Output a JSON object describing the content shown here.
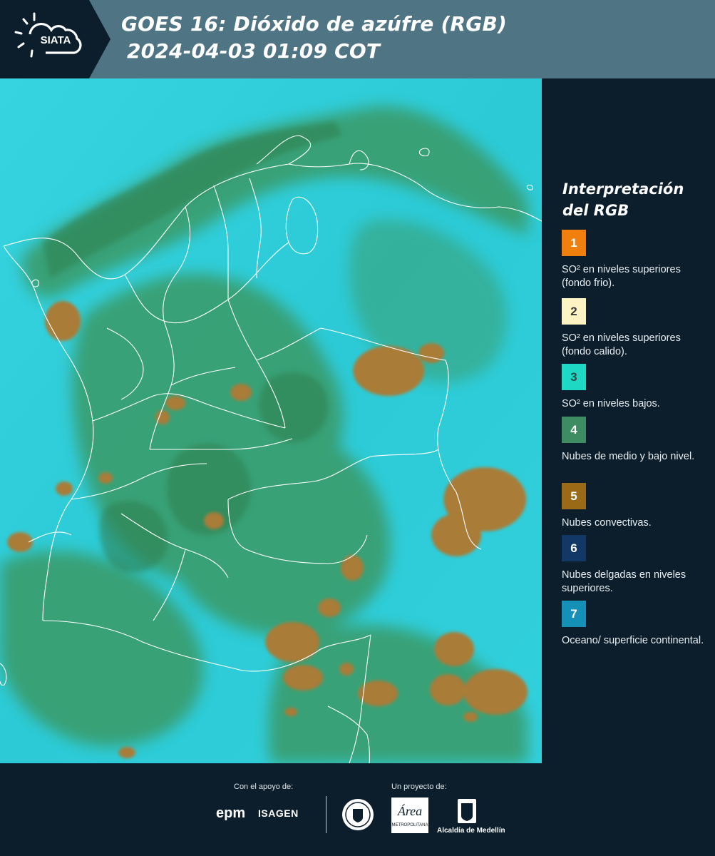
{
  "header": {
    "logo_text": "SIATA",
    "title_line1": "GOES 16: Dióxido de azúfre (RGB)",
    "title_line2": "2024-04-03 01:09 COT"
  },
  "map": {
    "description_colors": {
      "background_cyan": "#2fd0dc",
      "cloud_green": "#3c9a62",
      "convective_brown": "#a87a35",
      "borders": "#ffffff"
    }
  },
  "legend": {
    "title": "Interpretación del RGB",
    "items": [
      {
        "number": "1",
        "label": "SO² en niveles superiores (fondo frio).",
        "color": "#f07f0e",
        "text_color": "#ffffff"
      },
      {
        "number": "2",
        "label": "SO² en niveles superiores (fondo calido).",
        "color": "#fdf3c3",
        "text_color": "#3a3a3a"
      },
      {
        "number": "3",
        "label": "SO² en niveles bajos.",
        "color": "#1ed8c4",
        "text_color": "#2f4a4a"
      },
      {
        "number": "4",
        "label": "Nubes de medio y bajo nivel.",
        "color": "#3e8c62",
        "text_color": "#ffffff"
      },
      {
        "number": "5",
        "label": "Nubes convectivas.",
        "color": "#9a6a17",
        "text_color": "#ffffff"
      },
      {
        "number": "6",
        "label": "Nubes delgadas en niveles superiores.",
        "color": "#113866",
        "text_color": "#ffffff"
      },
      {
        "number": "7",
        "label": "Oceano/ superficie continental.",
        "color": "#1591b8",
        "text_color": "#ffffff"
      }
    ]
  },
  "footer": {
    "support_label": "Con el apoyo de:",
    "project_label": "Un proyecto de:",
    "epm": "epm",
    "isagen": "ISAGEN",
    "area": "Área",
    "area_sub": "METROPOLITANA",
    "alcaldia": "Alcaldía de Medellín"
  }
}
